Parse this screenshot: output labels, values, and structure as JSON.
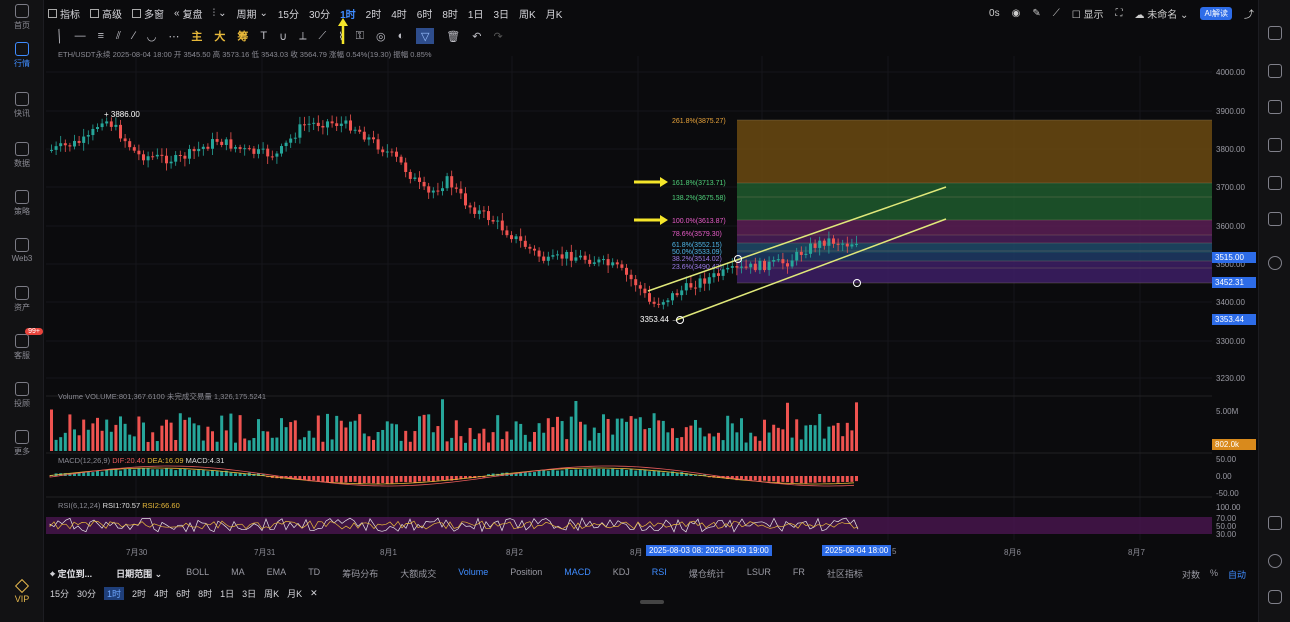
{
  "sidebar": {
    "items": [
      {
        "label": "首页"
      },
      {
        "label": "行情"
      },
      {
        "label": "快讯"
      },
      {
        "label": "数据"
      },
      {
        "label": "策略"
      },
      {
        "label": "Web3"
      },
      {
        "label": "资产"
      },
      {
        "label": "客服"
      },
      {
        "label": "投顾"
      },
      {
        "label": "更多"
      }
    ],
    "badge": "99+",
    "vip": "VIP"
  },
  "toolbar": {
    "indicators": "指标",
    "advanced": "高级",
    "multi": "多窗",
    "replay": "复盘",
    "period": "周期",
    "intervals": [
      "15分",
      "30分",
      "1时",
      "2时",
      "4时",
      "6时",
      "8时",
      "1日",
      "3日",
      "周K",
      "月K"
    ],
    "active_interval": "1时",
    "latency": "0s",
    "display": "显示",
    "unnamed": "未命名",
    "ai": "AI解读"
  },
  "drawing": {
    "main": "主",
    "big": "大",
    "chip": "筹"
  },
  "info": {
    "line": "ETH/USDT永续 2025-08-04 18:00 开 3545.50 高 3573.16 低 3543.03 收 3564.79 涨幅 0.54%(19.30) 振幅 0.85%"
  },
  "price_axis": [
    "4000.00",
    "3900.00",
    "3800.00",
    "3700.00",
    "3600.00",
    "3500.00",
    "3400.00",
    "3300.00",
    "3230.00"
  ],
  "price_tags": [
    {
      "value": "3515.00",
      "color": "#2d6ce8"
    },
    {
      "value": "3452.31",
      "color": "#2d6ce8"
    },
    {
      "value": "3353.44",
      "color": "#2d6ce8"
    }
  ],
  "annotations": {
    "high": "3886.00",
    "low": "3353.44"
  },
  "fib": [
    {
      "label": "261.8%(3875.27)",
      "color": "#e8a33a"
    },
    {
      "label": "161.8%(3713.71)",
      "color": "#4fd07a"
    },
    {
      "label": "138.2%(3675.58)",
      "color": "#4fd07a"
    },
    {
      "label": "100.0%(3613.87)",
      "color": "#e85cc8"
    },
    {
      "label": "78.6%(3579.30)",
      "color": "#e85cc8"
    },
    {
      "label": "61.8%(3552.15)",
      "color": "#4fb6e8"
    },
    {
      "label": "50.0%(3533.09)",
      "color": "#4fb6e8"
    },
    {
      "label": "38.2%(3514.02)",
      "color": "#9b7ae8"
    },
    {
      "label": "23.6%(3490.43)",
      "color": "#9b7ae8"
    }
  ],
  "volume": {
    "label": "Volume VOLUME:801,367.6100 未完成交易量 1,326,175.5241",
    "axis_top": "5.00M",
    "tag": "802.0k"
  },
  "macd": {
    "label": "MACD(12,26,9)",
    "dif": "DIF:20.40",
    "dea": "DEA:16.09",
    "macd": "MACD:4.31",
    "axis": [
      "50.00",
      "0.00",
      "-50.00"
    ]
  },
  "rsi": {
    "label": "RSI(6,12,24)",
    "rsi1": "RSI1:70.57",
    "rsi2": "RSI2:66.60",
    "axis": [
      "100.00",
      "70.00",
      "50.00",
      "30.00"
    ]
  },
  "dates": {
    "labels": [
      "7月30",
      "7月31",
      "8月1",
      "8月2",
      "8月",
      "5",
      "8月6",
      "8月7"
    ],
    "range": "2025-08-03 08:   2025-08-03 19:00",
    "cursor": "2025-08-04 18:00"
  },
  "indicators": {
    "locate": "定位到...",
    "date_range": "日期范围",
    "items": [
      "BOLL",
      "MA",
      "EMA",
      "TD",
      "筹码分布",
      "大额成交",
      "Volume",
      "Position",
      "MACD",
      "KDJ",
      "RSI",
      "爆仓统计",
      "LSUR",
      "FR",
      "社区指标"
    ],
    "active": [
      "Volume",
      "MACD",
      "RSI"
    ],
    "right": [
      "对数",
      "%",
      "自动"
    ]
  },
  "bottom_intervals": [
    "15分",
    "30分",
    "1时",
    "2时",
    "4时",
    "6时",
    "8时",
    "1日",
    "3日",
    "周K",
    "月K"
  ],
  "bottom_active": "1时",
  "colors": {
    "up": "#26a69a",
    "down": "#ef5350",
    "accent": "#2d6ce8",
    "arrow": "#f5e62a"
  }
}
